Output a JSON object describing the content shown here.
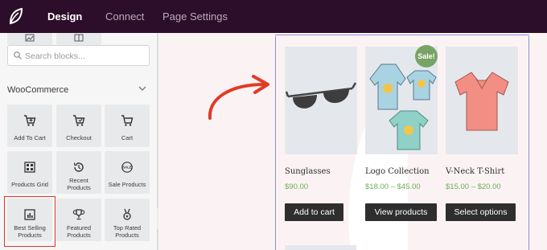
{
  "topbar": {
    "tabs": [
      {
        "label": "Design",
        "active": true
      },
      {
        "label": "Connect",
        "active": false
      },
      {
        "label": "Page Settings",
        "active": false
      }
    ]
  },
  "sidebar": {
    "search_placeholder": "Search blocks...",
    "section_title": "WooCommerce",
    "blocks": [
      {
        "label": "Add To Cart",
        "icon": "cart-plus-icon"
      },
      {
        "label": "Checkout",
        "icon": "cart-check-icon"
      },
      {
        "label": "Cart",
        "icon": "cart-icon"
      },
      {
        "label": "Products Grid",
        "icon": "grid-icon"
      },
      {
        "label": "Recent Products",
        "icon": "history-icon"
      },
      {
        "label": "Sale Products",
        "icon": "sale-tag-icon"
      },
      {
        "label": "Best Selling Products",
        "icon": "bar-chart-icon"
      },
      {
        "label": "Featured Products",
        "icon": "trophy-icon"
      },
      {
        "label": "Top Rated Products",
        "icon": "medal-icon"
      }
    ],
    "highlight_color": "#e0362b"
  },
  "preview": {
    "products": [
      {
        "name": "Sunglasses",
        "price": "$90.00",
        "button": "Add to cart",
        "sale": false
      },
      {
        "name": "Logo Collection",
        "price": "$18.00 – $45.00",
        "button": "View products",
        "sale": true
      },
      {
        "name": "V-Neck T-Shirt",
        "price": "$15.00 – $20.00",
        "button": "Select options",
        "sale": false
      }
    ],
    "sale_label": "Sale!",
    "price_color": "#6fae5a",
    "arrow_color": "#e23a26"
  }
}
